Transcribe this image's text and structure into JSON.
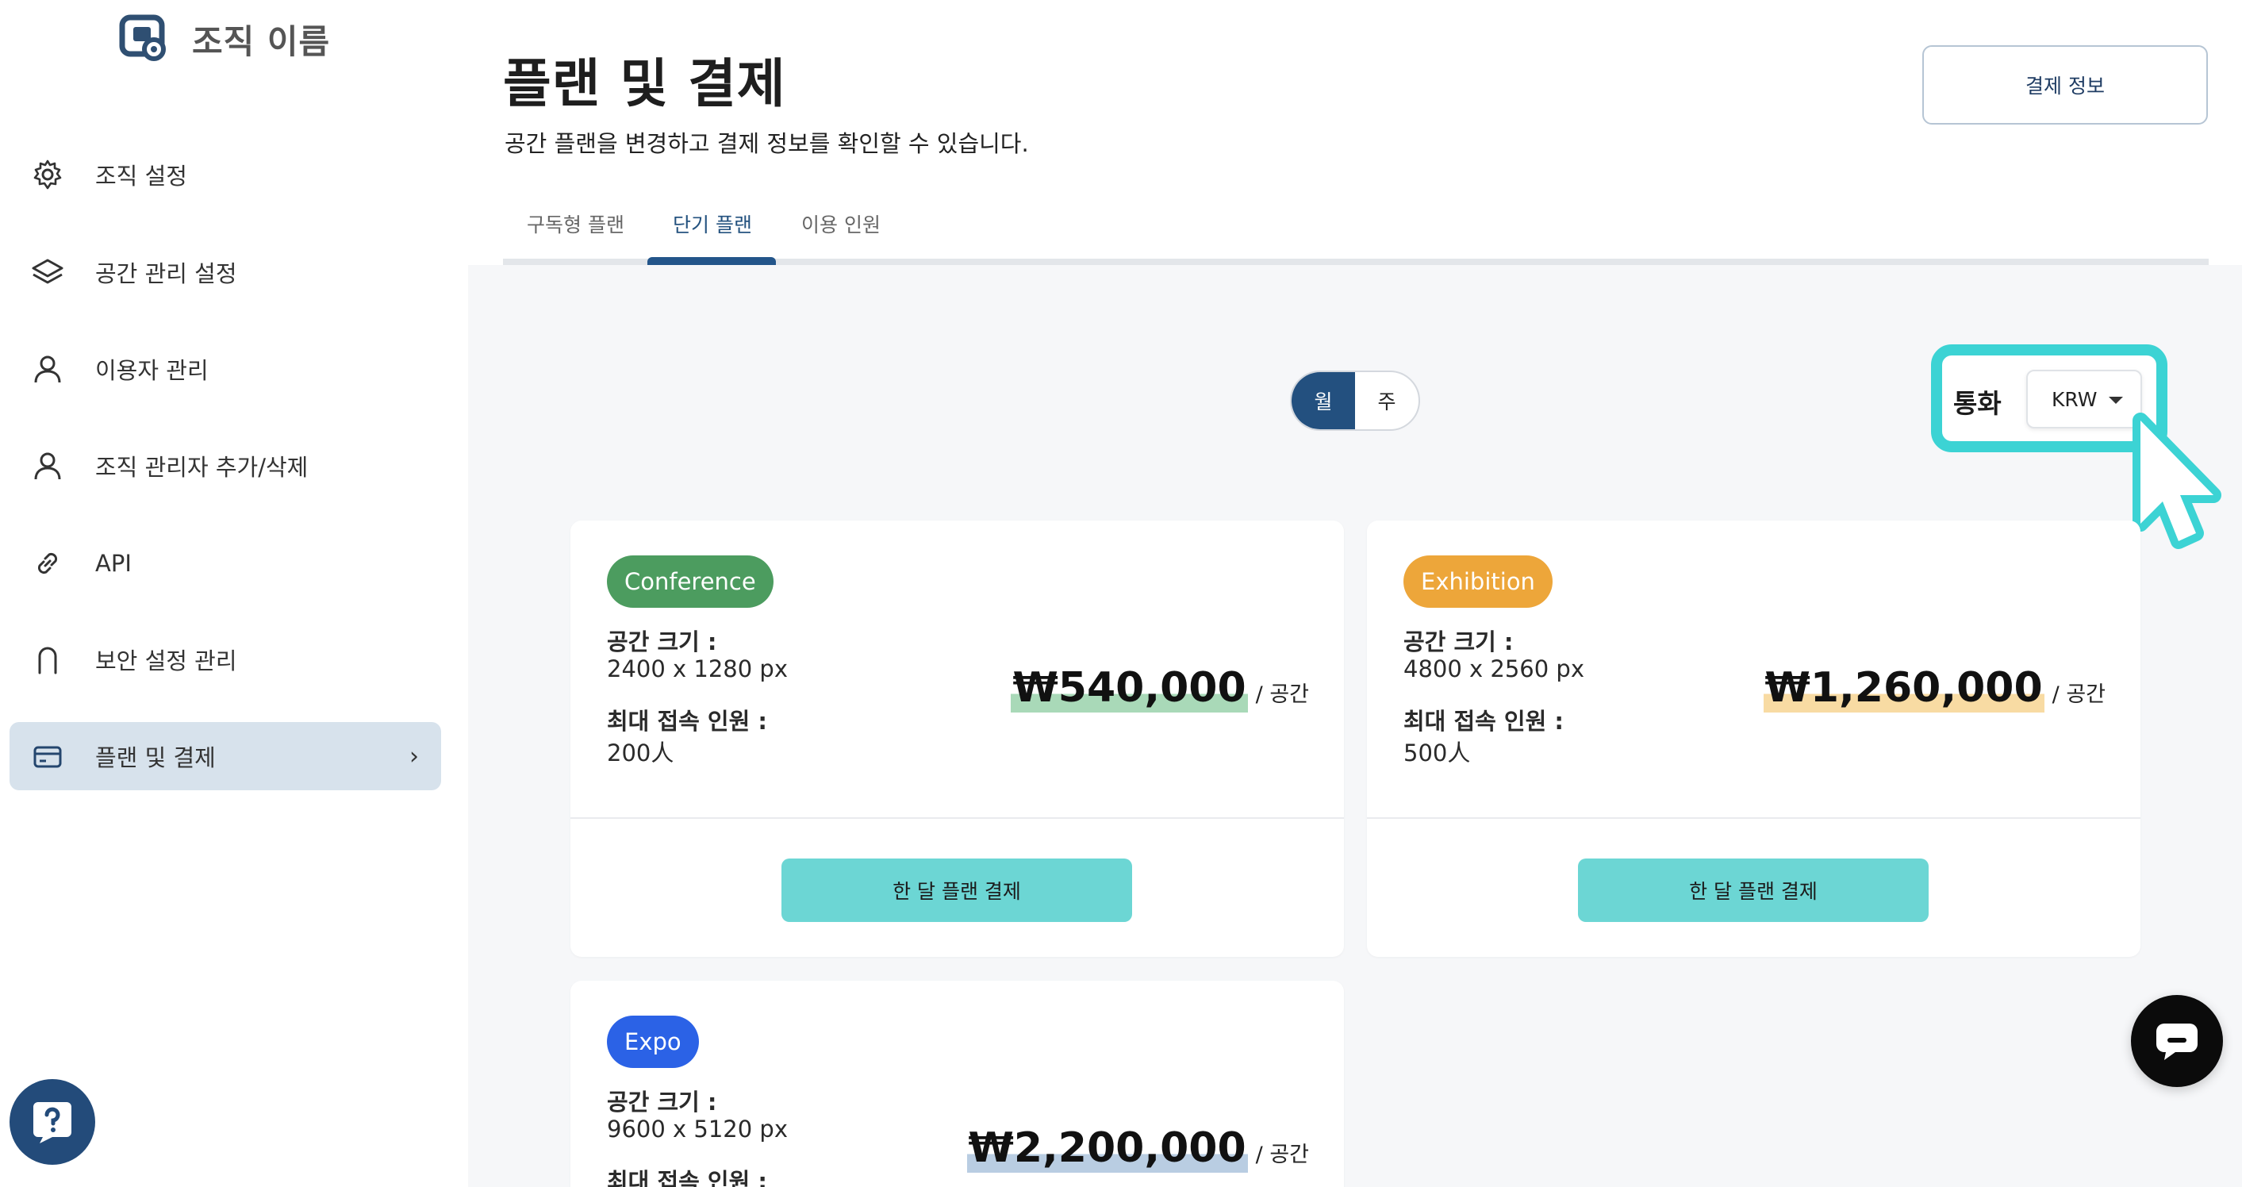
{
  "org": {
    "name": "조직 이름"
  },
  "sidebar": {
    "items": [
      {
        "label": "조직 설정",
        "icon": "gear-icon"
      },
      {
        "label": "공간 관리 설정",
        "icon": "layers-icon"
      },
      {
        "label": "이용자 관리",
        "icon": "user-icon"
      },
      {
        "label": "조직 관리자 추가/삭제",
        "icon": "user-icon"
      },
      {
        "label": "API",
        "icon": "link-icon"
      },
      {
        "label": "보안 설정 관리",
        "icon": "lock-icon"
      },
      {
        "label": "플랜 및 결제",
        "icon": "card-icon",
        "active": true,
        "chevron": "›"
      }
    ]
  },
  "header": {
    "title": "플랜 및 결제",
    "subtitle": "공간 플랜을 변경하고 결제 정보를 확인할 수 있습니다.",
    "billing_info_label": "결제 정보"
  },
  "tabs": [
    {
      "label": "구독형 플랜",
      "active": false
    },
    {
      "label": "단기 플랜",
      "active": true
    },
    {
      "label": "이용 인원",
      "active": false
    }
  ],
  "period_toggle": {
    "options": [
      "월",
      "주"
    ],
    "selected": "월"
  },
  "currency": {
    "label": "통화",
    "selected": "KRW"
  },
  "plans": [
    {
      "name": "Conference",
      "badge_color": "#4c9c5f",
      "highlight_color": "#a9d9b8",
      "size_label": "공간 크기 :",
      "size_value": "2400 x 1280 px",
      "max_label": "최대 접속 인원 :",
      "max_value": "200人",
      "price": "₩540,000",
      "per": "/ 공간",
      "button_label": "한 달 플랜 결제"
    },
    {
      "name": "Exhibition",
      "badge_color": "#eda63a",
      "highlight_color": "#f8dba3",
      "size_label": "공간 크기 :",
      "size_value": "4800 x 2560 px",
      "max_label": "최대 접속 인원 :",
      "max_value": "500人",
      "price": "₩1,260,000",
      "per": "/ 공간",
      "button_label": "한 달 플랜 결제"
    },
    {
      "name": "Expo",
      "badge_color": "#2b62e6",
      "highlight_color": "#b9cde2",
      "size_label": "공간 크기 :",
      "size_value": "9600 x 5120 px",
      "max_label": "최대 접속 인원 :",
      "max_value": "",
      "price": "₩2,200,000",
      "per": "/ 공간",
      "button_label": ""
    }
  ]
}
